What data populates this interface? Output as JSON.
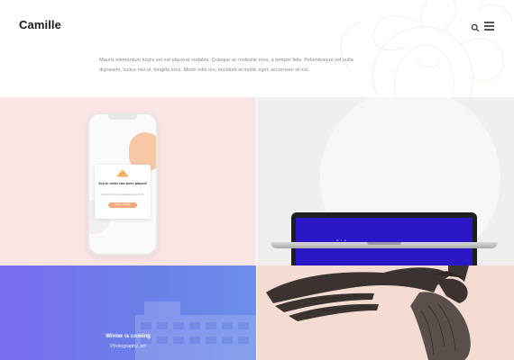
{
  "header": {
    "logo": "Camille",
    "search_icon": "search-icon",
    "menu_icon": "hamburger-menu-icon",
    "intro": "Mauris elementum turpis vel est placerat sodales. Quisque ac molestie eros, a tempor felis. Pellentesque vel nulla dignissim, luctus nisi ut, fringilla eros. Morbi odio leo, tincidunt at mollis eget, accumsan id nisl."
  },
  "projects": [
    {
      "background": "#fbe4e4",
      "phone": {
        "order_title": "You're order has been placed!",
        "order_subtitle": "Delight will ship by estimated time 14:00",
        "button_label": "TRACK ORDER"
      }
    },
    {
      "background": "#efefef",
      "screen_color": "#2a17c7",
      "screen": {
        "logo": "M I A",
        "text": "My name is Lauren and I'm a full-time freelance Art Director and Designer currently residing in Moscow. Photoshop, Keynote & Sketch and InDesign are my daily tools. I love making things.",
        "footer": "hello@example.com"
      }
    },
    {
      "title": "Winter is coming",
      "subtitle": "Photography, art"
    },
    {
      "background": "#f5dbd1"
    }
  ]
}
